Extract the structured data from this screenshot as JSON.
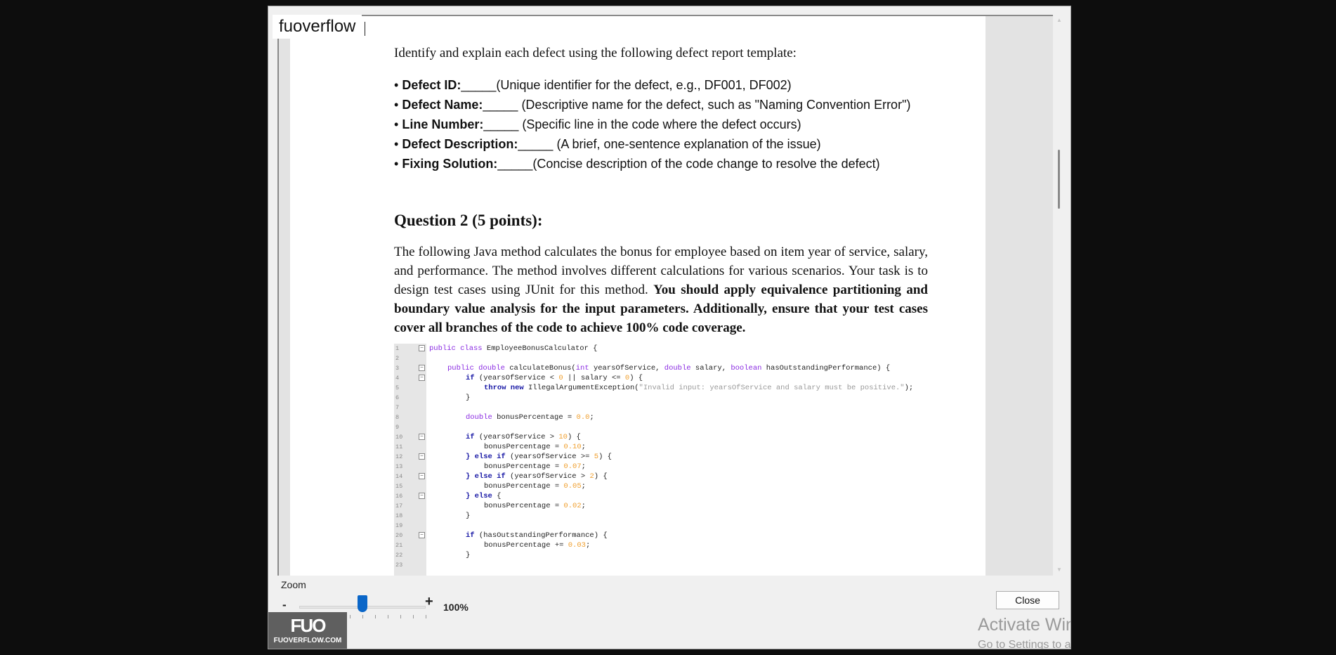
{
  "window": {
    "title": "fuoverflow"
  },
  "document": {
    "intro": "Identify and explain each defect using the following defect report template:",
    "defect_fields": [
      {
        "label": "Defect ID:",
        "blank": "_____",
        "hint": "(Unique identifier for the defect, e.g., DF001, DF002)"
      },
      {
        "label": "Defect Name:",
        "blank": "_____",
        "hint": " (Descriptive name for the defect, such as \"Naming Convention Error\")"
      },
      {
        "label": "Line Number:",
        "blank": "_____",
        "hint": " (Specific line in the code where the defect occurs)"
      },
      {
        "label": "Defect Description:",
        "blank": "_____",
        "hint": " (A brief, one-sentence explanation of the issue)"
      },
      {
        "label": "Fixing Solution:",
        "blank": "_____",
        "hint": "(Concise description of the code change to resolve the defect)"
      }
    ],
    "bullet": "•",
    "question_title": "Question 2 (5 points):",
    "question_body_plain": "The following Java method calculates the bonus for employee based on item year of service, salary, and performance. The method involves different calculations for various scenarios. Your task is to design test cases using JUnit for this method. ",
    "question_body_bold": "You should apply equivalence partitioning and boundary value analysis for the input parameters. Additionally, ensure that your test cases cover all branches of the code to achieve 100% code coverage."
  },
  "code": {
    "line_numbers": [
      "1",
      "2",
      "3",
      "4",
      "5",
      "6",
      "7",
      "8",
      "9",
      "10",
      "11",
      "12",
      "13",
      "14",
      "15",
      "16",
      "17",
      "18",
      "19",
      "20",
      "21",
      "22",
      "23"
    ],
    "l1_kw": "public class",
    "l1_rest": " EmployeeBonusCalculator {",
    "l3_kw1": "public double",
    "l3_a": " calculateBonus(",
    "l3_kw2": "int",
    "l3_b": " yearsOfService, ",
    "l3_kw3": "double",
    "l3_c": " salary, ",
    "l3_kw4": "boolean",
    "l3_d": " hasOutstandingPerformance) {",
    "l4_kw": "if",
    "l4_a": " (yearsOfService < ",
    "l4_n1": "0",
    "l4_b": " || salary <= ",
    "l4_n2": "0",
    "l4_c": ") {",
    "l5_kw": "throw new",
    "l5_a": " IllegalArgumentException(",
    "l5_str": "\"Invalid input: yearsOfService and salary must be positive.\"",
    "l5_b": ");",
    "close_brace": "}",
    "l8_kw": "double",
    "l8_a": " bonusPercentage = ",
    "l8_n": "0.0",
    "semi": ";",
    "l10_kw": "if",
    "l10_a": " (yearsOfService > ",
    "l10_n": "10",
    "l10_b": ") {",
    "assign": "bonusPercentage = ",
    "l11_n": "0.10",
    "l12_kw": "} else if",
    "l12_a": " (yearsOfService >= ",
    "l12_n": "5",
    "l12_b": ") {",
    "l13_n": "0.07",
    "l14_kw": "} else if",
    "l14_a": " (yearsOfService > ",
    "l14_n": "2",
    "l14_b": ") {",
    "l15_n": "0.05",
    "l16_kw": "} else",
    "l16_b": " {",
    "l17_n": "0.02",
    "l20_kw": "if",
    "l20_a": " (hasOutstandingPerformance) {",
    "l21_a": "bonusPercentage += ",
    "l21_n": "0.03",
    "fold_mark": "−"
  },
  "controls": {
    "zoom_label": "Zoom",
    "zoom_minus": "-",
    "zoom_plus": "+",
    "zoom_value": "100%",
    "zoom_level": 0.5,
    "close_label": "Close"
  },
  "logo": {
    "mark": "FUO",
    "text": "FUOVERFLOW.COM"
  },
  "watermark": {
    "title": "Activate Windows",
    "subtitle": "Go to Settings to activate Windows."
  },
  "icons": {
    "scroll_up": "▲",
    "scroll_down": "▼"
  },
  "colors": {
    "accent": "#0a66c8",
    "keyword": "#8a2be2",
    "keyword_bold": "#1a1aa6",
    "number": "#f0a030",
    "string": "#9a9a9a"
  }
}
